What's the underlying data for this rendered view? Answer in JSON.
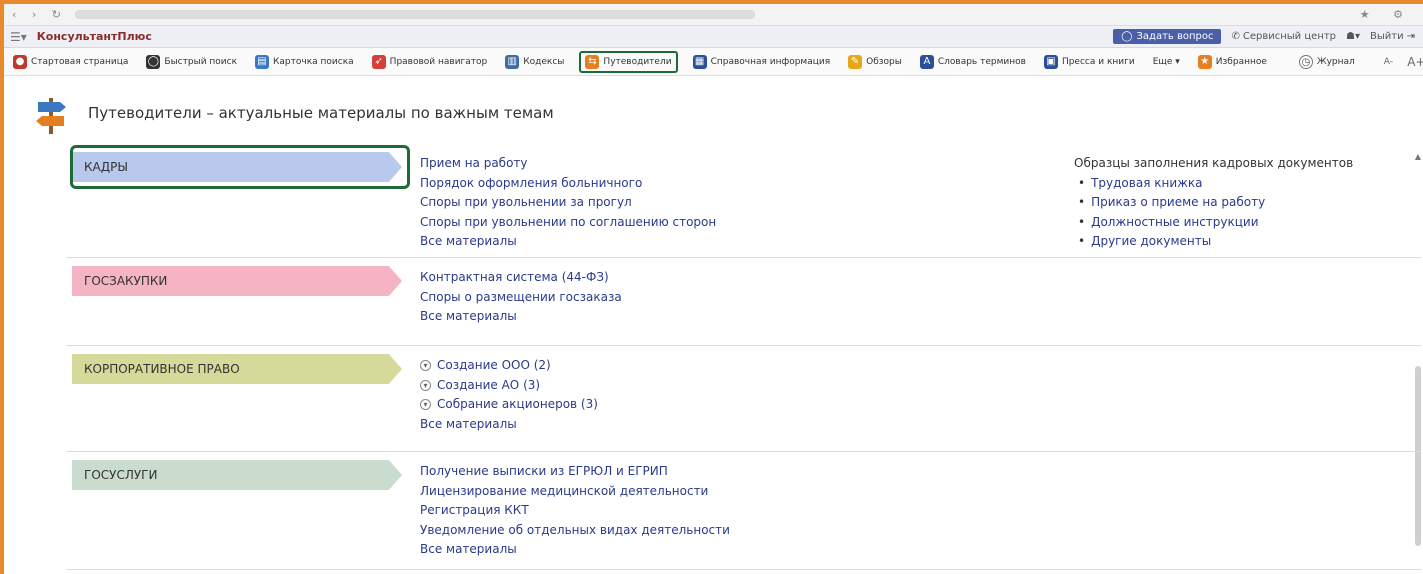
{
  "app": {
    "brand": "КонсультантПлюс"
  },
  "appbar": {
    "ask_button": "Задать вопрос",
    "service_center": "Сервисный центр",
    "exit": "Выйти"
  },
  "toolbar": {
    "items": [
      {
        "label": "Стартовая страница",
        "icon": "home-icon",
        "color": "#c0392b"
      },
      {
        "label": "Быстрый поиск",
        "icon": "search-icon",
        "color": "#333333"
      },
      {
        "label": "Карточка поиска",
        "icon": "card-search-icon",
        "color": "#3a78c2"
      },
      {
        "label": "Правовой навигатор",
        "icon": "navigator-icon",
        "color": "#d43f3a"
      },
      {
        "label": "Кодексы",
        "icon": "codex-icon",
        "color": "#3a6ea5"
      },
      {
        "label": "Путеводители",
        "icon": "signpost-icon",
        "color": "#e67e22",
        "active": true
      },
      {
        "label": "Справочная информация",
        "icon": "reference-icon",
        "color": "#2d4f9a"
      },
      {
        "label": "Обзоры",
        "icon": "reviews-icon",
        "color": "#e6a817"
      },
      {
        "label": "Словарь терминов",
        "icon": "dictionary-icon",
        "color": "#2d4f9a"
      },
      {
        "label": "Пресса и книги",
        "icon": "press-icon",
        "color": "#2d4f9a"
      },
      {
        "label": "Еще ▾",
        "icon": "",
        "color": "#333333"
      }
    ],
    "favorites": "Избранное",
    "journal": "Журнал",
    "font_smaller": "А-",
    "font_larger": "А+"
  },
  "page": {
    "title": "Путеводители – актуальные материалы по важным темам"
  },
  "sections": [
    {
      "tag": "КАДРЫ",
      "color": "#b9c9ee",
      "links": [
        "Прием на работу",
        "Порядок оформления больничного",
        "Споры при увольнении за прогул",
        "Споры при увольнении по соглашению сторон",
        "Все материалы"
      ],
      "samples_title": "Образцы заполнения кадровых документов",
      "samples": [
        "Трудовая книжка",
        "Приказ о приеме на работу",
        "Должностные инструкции",
        "Другие документы"
      ]
    },
    {
      "tag": "ГОСЗАКУПКИ",
      "color": "#f4b4c3",
      "links": [
        "Контрактная система (44-ФЗ)",
        "Споры о размещении госзаказа",
        "Все материалы"
      ]
    },
    {
      "tag": "КОРПОРАТИВНОЕ ПРАВО",
      "color": "#d5da9a",
      "expandable": [
        "Создание ООО (2)",
        "Создание АО (3)",
        "Собрание акционеров (3)"
      ],
      "links": [
        "Все материалы"
      ]
    },
    {
      "tag": "ГОСУСЛУГИ",
      "color": "#c9dccd",
      "links": [
        "Получение выписки из ЕГРЮЛ и ЕГРИП",
        "Лицензирование медицинской деятельности",
        "Регистрация ККТ",
        "Уведомление об отдельных видах деятельности",
        "Все материалы"
      ]
    }
  ]
}
